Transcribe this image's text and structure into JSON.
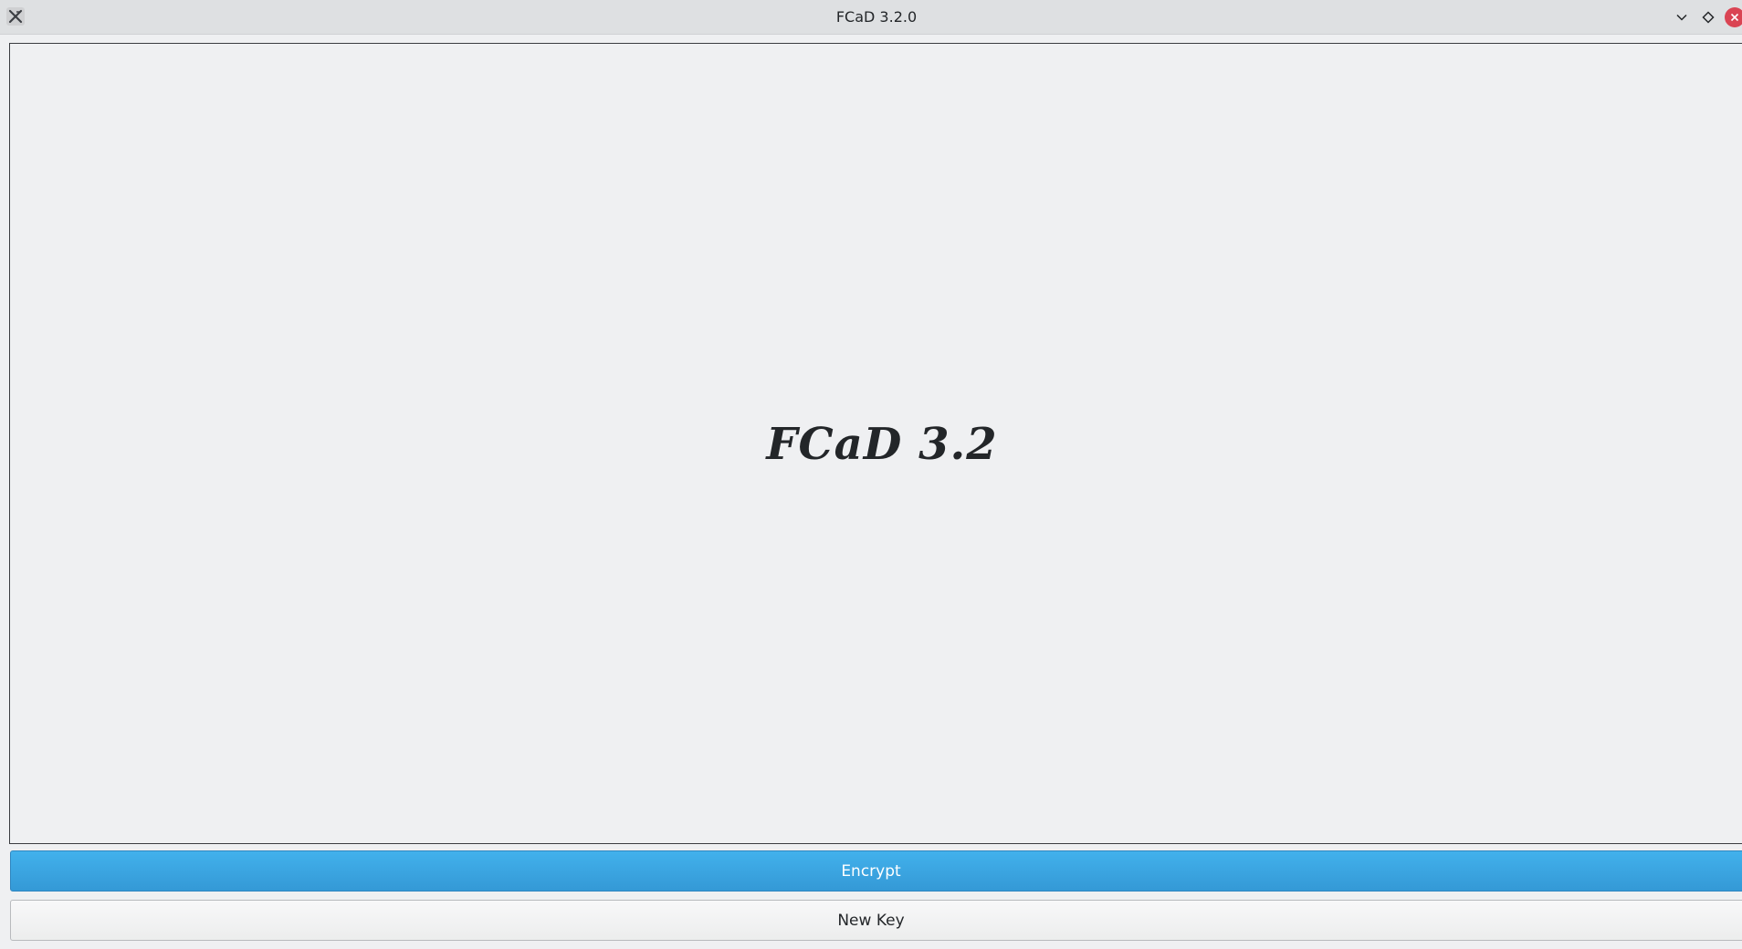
{
  "window": {
    "title": "FCaD 3.2.0",
    "app_icon": "x-app-icon",
    "controls": {
      "minimize_icon": "chevron-down-icon",
      "maximize_icon": "diamond-icon",
      "close_icon": "close-icon"
    }
  },
  "main": {
    "logo_text": "FCaD 3.2"
  },
  "buttons": {
    "encrypt_label": "Encrypt",
    "new_key_label": "New Key"
  },
  "colors": {
    "accent": "#3daee9",
    "close": "#da4453"
  }
}
